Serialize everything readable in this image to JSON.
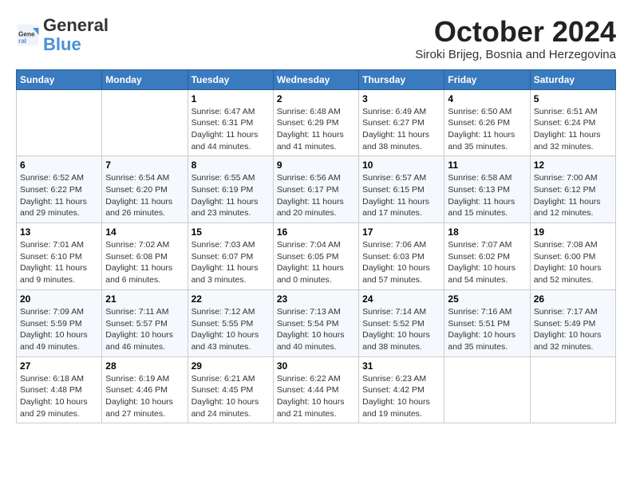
{
  "header": {
    "logo_general": "General",
    "logo_blue": "Blue",
    "month": "October 2024",
    "location": "Siroki Brijeg, Bosnia and Herzegovina"
  },
  "weekdays": [
    "Sunday",
    "Monday",
    "Tuesday",
    "Wednesday",
    "Thursday",
    "Friday",
    "Saturday"
  ],
  "weeks": [
    [
      {
        "day": "",
        "info": ""
      },
      {
        "day": "",
        "info": ""
      },
      {
        "day": "1",
        "info": "Sunrise: 6:47 AM\nSunset: 6:31 PM\nDaylight: 11 hours and 44 minutes."
      },
      {
        "day": "2",
        "info": "Sunrise: 6:48 AM\nSunset: 6:29 PM\nDaylight: 11 hours and 41 minutes."
      },
      {
        "day": "3",
        "info": "Sunrise: 6:49 AM\nSunset: 6:27 PM\nDaylight: 11 hours and 38 minutes."
      },
      {
        "day": "4",
        "info": "Sunrise: 6:50 AM\nSunset: 6:26 PM\nDaylight: 11 hours and 35 minutes."
      },
      {
        "day": "5",
        "info": "Sunrise: 6:51 AM\nSunset: 6:24 PM\nDaylight: 11 hours and 32 minutes."
      }
    ],
    [
      {
        "day": "6",
        "info": "Sunrise: 6:52 AM\nSunset: 6:22 PM\nDaylight: 11 hours and 29 minutes."
      },
      {
        "day": "7",
        "info": "Sunrise: 6:54 AM\nSunset: 6:20 PM\nDaylight: 11 hours and 26 minutes."
      },
      {
        "day": "8",
        "info": "Sunrise: 6:55 AM\nSunset: 6:19 PM\nDaylight: 11 hours and 23 minutes."
      },
      {
        "day": "9",
        "info": "Sunrise: 6:56 AM\nSunset: 6:17 PM\nDaylight: 11 hours and 20 minutes."
      },
      {
        "day": "10",
        "info": "Sunrise: 6:57 AM\nSunset: 6:15 PM\nDaylight: 11 hours and 17 minutes."
      },
      {
        "day": "11",
        "info": "Sunrise: 6:58 AM\nSunset: 6:13 PM\nDaylight: 11 hours and 15 minutes."
      },
      {
        "day": "12",
        "info": "Sunrise: 7:00 AM\nSunset: 6:12 PM\nDaylight: 11 hours and 12 minutes."
      }
    ],
    [
      {
        "day": "13",
        "info": "Sunrise: 7:01 AM\nSunset: 6:10 PM\nDaylight: 11 hours and 9 minutes."
      },
      {
        "day": "14",
        "info": "Sunrise: 7:02 AM\nSunset: 6:08 PM\nDaylight: 11 hours and 6 minutes."
      },
      {
        "day": "15",
        "info": "Sunrise: 7:03 AM\nSunset: 6:07 PM\nDaylight: 11 hours and 3 minutes."
      },
      {
        "day": "16",
        "info": "Sunrise: 7:04 AM\nSunset: 6:05 PM\nDaylight: 11 hours and 0 minutes."
      },
      {
        "day": "17",
        "info": "Sunrise: 7:06 AM\nSunset: 6:03 PM\nDaylight: 10 hours and 57 minutes."
      },
      {
        "day": "18",
        "info": "Sunrise: 7:07 AM\nSunset: 6:02 PM\nDaylight: 10 hours and 54 minutes."
      },
      {
        "day": "19",
        "info": "Sunrise: 7:08 AM\nSunset: 6:00 PM\nDaylight: 10 hours and 52 minutes."
      }
    ],
    [
      {
        "day": "20",
        "info": "Sunrise: 7:09 AM\nSunset: 5:59 PM\nDaylight: 10 hours and 49 minutes."
      },
      {
        "day": "21",
        "info": "Sunrise: 7:11 AM\nSunset: 5:57 PM\nDaylight: 10 hours and 46 minutes."
      },
      {
        "day": "22",
        "info": "Sunrise: 7:12 AM\nSunset: 5:55 PM\nDaylight: 10 hours and 43 minutes."
      },
      {
        "day": "23",
        "info": "Sunrise: 7:13 AM\nSunset: 5:54 PM\nDaylight: 10 hours and 40 minutes."
      },
      {
        "day": "24",
        "info": "Sunrise: 7:14 AM\nSunset: 5:52 PM\nDaylight: 10 hours and 38 minutes."
      },
      {
        "day": "25",
        "info": "Sunrise: 7:16 AM\nSunset: 5:51 PM\nDaylight: 10 hours and 35 minutes."
      },
      {
        "day": "26",
        "info": "Sunrise: 7:17 AM\nSunset: 5:49 PM\nDaylight: 10 hours and 32 minutes."
      }
    ],
    [
      {
        "day": "27",
        "info": "Sunrise: 6:18 AM\nSunset: 4:48 PM\nDaylight: 10 hours and 29 minutes."
      },
      {
        "day": "28",
        "info": "Sunrise: 6:19 AM\nSunset: 4:46 PM\nDaylight: 10 hours and 27 minutes."
      },
      {
        "day": "29",
        "info": "Sunrise: 6:21 AM\nSunset: 4:45 PM\nDaylight: 10 hours and 24 minutes."
      },
      {
        "day": "30",
        "info": "Sunrise: 6:22 AM\nSunset: 4:44 PM\nDaylight: 10 hours and 21 minutes."
      },
      {
        "day": "31",
        "info": "Sunrise: 6:23 AM\nSunset: 4:42 PM\nDaylight: 10 hours and 19 minutes."
      },
      {
        "day": "",
        "info": ""
      },
      {
        "day": "",
        "info": ""
      }
    ]
  ]
}
